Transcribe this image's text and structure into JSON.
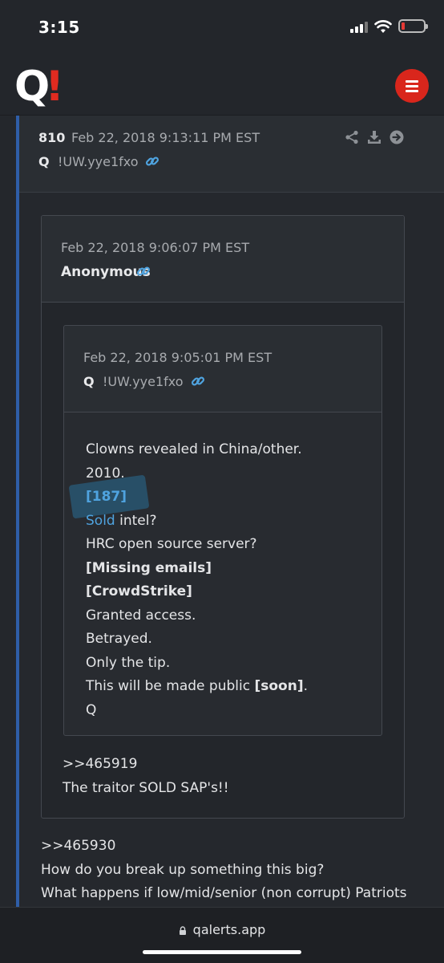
{
  "status_bar": {
    "time": "3:15"
  },
  "header": {
    "logo_q": "Q",
    "logo_bang": "!"
  },
  "post": {
    "number": "810",
    "date": "Feb 22, 2018 9:13:11 PM EST",
    "author": "Q",
    "tripcode": "!UW.yye1fxo"
  },
  "quote1": {
    "date": "Feb 22, 2018 9:06:07 PM EST",
    "author": "Anonymous",
    "lines": [
      ">>465919",
      "The traitor SOLD SAP's!!"
    ]
  },
  "quote2": {
    "date": "Feb 22, 2018 9:05:01 PM EST",
    "author": "Q",
    "tripcode": "!UW.yye1fxo",
    "lines": {
      "l1": "Clowns revealed in China/other.",
      "l2": "2010.",
      "l3": "[187]",
      "l4_a": "Sold",
      "l4_b": " intel?",
      "l5": "HRC open source server?",
      "l6": "[Missing emails]",
      "l7": "[CrowdStrike]",
      "l8": "Granted access.",
      "l9": "Betrayed.",
      "l10": "Only the tip.",
      "l11_a": "This will be made public ",
      "l11_b": "[soon]",
      "l11_c": ".",
      "l12": "Q"
    }
  },
  "body": {
    "lines": [
      ">>465930",
      "How do you break up something this big?",
      "What happens if low/mid/senior (non corrupt) Patriots"
    ]
  },
  "url_bar": {
    "url": "qalerts.app"
  },
  "icons": [
    "share-icon",
    "download-icon",
    "arrow-right-circle-icon",
    "link-icon",
    "menu-icon",
    "lock-icon"
  ],
  "colors": {
    "accent": "#e02b20",
    "link": "#4fa3df",
    "left_bar": "#2f5ea8"
  }
}
